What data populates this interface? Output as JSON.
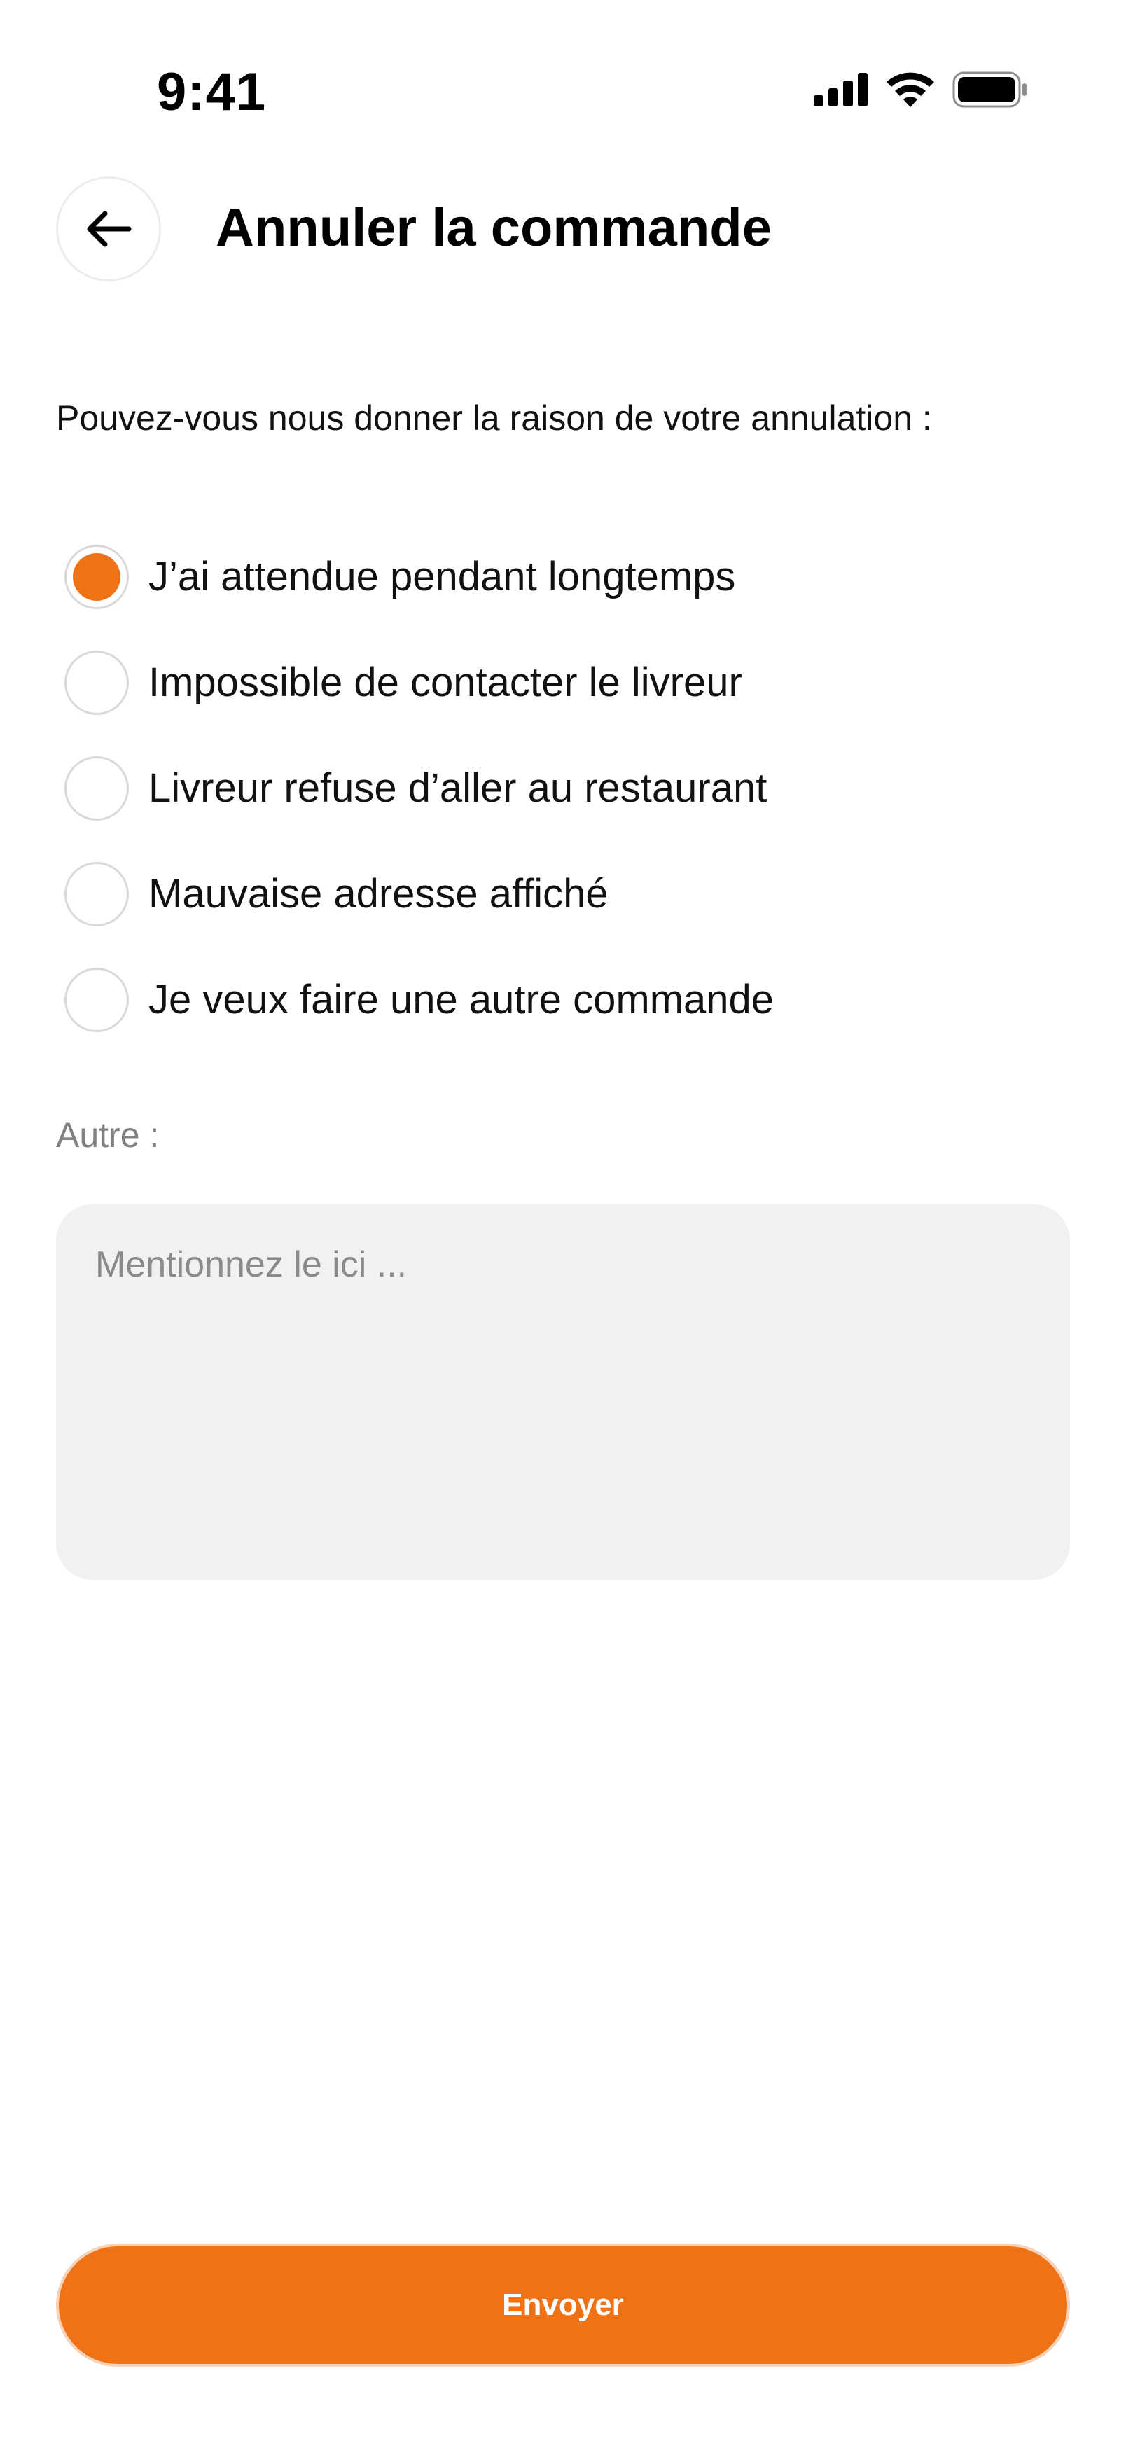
{
  "status_bar": {
    "time": "9:41",
    "icons": [
      "signal-icon",
      "wifi-icon",
      "battery-icon"
    ]
  },
  "header": {
    "back_icon": "arrow-left-icon",
    "title": "Annuler la commande"
  },
  "question": "Pouvez-vous nous donner la raison de votre annulation :",
  "reasons": [
    {
      "label": "J’ai attendue pendant longtemps",
      "selected": true
    },
    {
      "label": "Impossible de contacter le livreur",
      "selected": false
    },
    {
      "label": "Livreur refuse d’aller au restaurant",
      "selected": false
    },
    {
      "label": "Mauvaise adresse affiché",
      "selected": false
    },
    {
      "label": "Je veux faire une autre commande",
      "selected": false
    }
  ],
  "other": {
    "label": "Autre :",
    "placeholder": "Mentionnez le ici ...",
    "value": ""
  },
  "submit_label": "Envoyer",
  "colors": {
    "accent": "#f07216",
    "input_bg": "#f1f1f1",
    "muted_text": "#808080"
  }
}
